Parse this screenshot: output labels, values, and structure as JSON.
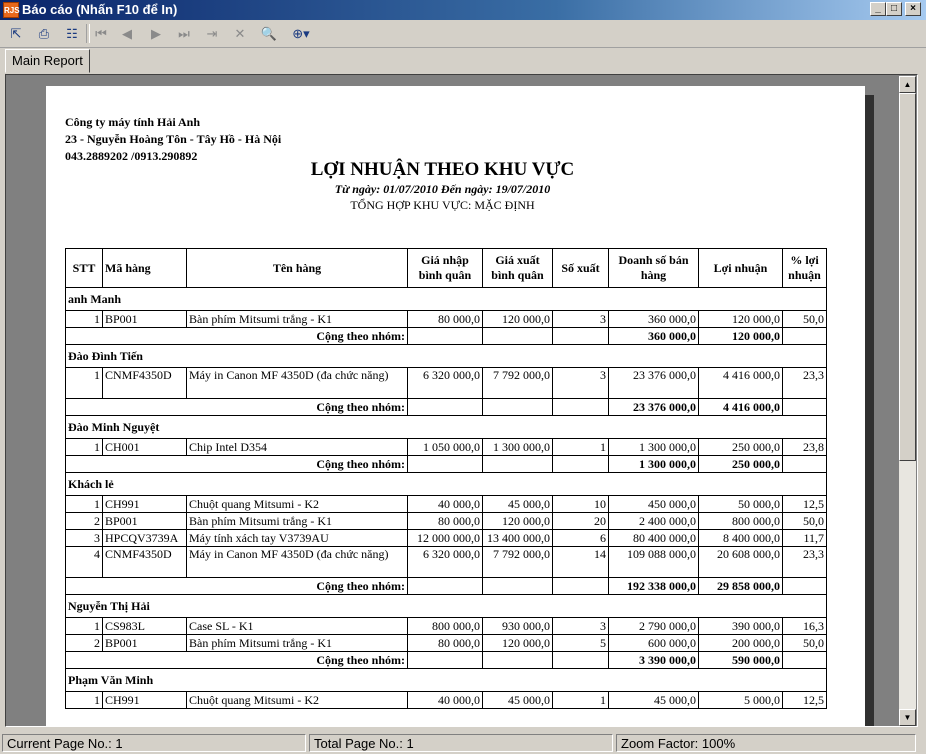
{
  "window": {
    "title": "Báo cáo (Nhấn F10 để In)",
    "icon_text": "RJS"
  },
  "tab": {
    "label": "Main Report"
  },
  "company": {
    "name": "Công ty máy tính Hải Anh",
    "address": "23 - Nguyễn Hoàng Tôn - Tây Hồ - Hà Nội",
    "phone": "043.2889202 /0913.290892"
  },
  "report": {
    "title": "LỢI NHUẬN THEO KHU VỰC",
    "date_range": "Từ ngày: 01/07/2010 Đến ngày: 19/07/2010",
    "summary": "TỔNG HỢP KHU VỰC: MẶC ĐỊNH"
  },
  "columns": [
    "STT",
    "Mã hàng",
    "Tên hàng",
    "Giá nhập bình quân",
    "Giá xuất bình quân",
    "Số xuất",
    "Doanh số bán hàng",
    "Lợi nhuận",
    "% lợi nhuận"
  ],
  "subtotal_label": "Cộng theo nhóm:",
  "groups": [
    {
      "name": "anh Manh",
      "rows": [
        [
          "1",
          "BP001",
          "Bàn phím Mitsumi trắng - K1",
          "80 000,0",
          "120 000,0",
          "3",
          "360 000,0",
          "120 000,0",
          "50,0"
        ]
      ],
      "total_revenue": "360 000,0",
      "total_profit": "120 000,0"
    },
    {
      "name": "Đào Đình Tiến",
      "rows": [
        [
          "1",
          "CNMF4350D",
          "Máy in Canon MF 4350D (đa chức năng)",
          "6 320 000,0",
          "7 792 000,0",
          "3",
          "23 376 000,0",
          "4 416 000,0",
          "23,3"
        ]
      ],
      "total_revenue": "23 376 000,0",
      "total_profit": "4 416 000,0"
    },
    {
      "name": "Đào Minh Nguyệt",
      "rows": [
        [
          "1",
          "CH001",
          "Chip Intel D354",
          "1 050 000,0",
          "1 300 000,0",
          "1",
          "1 300 000,0",
          "250 000,0",
          "23,8"
        ]
      ],
      "total_revenue": "1 300 000,0",
      "total_profit": "250 000,0"
    },
    {
      "name": "Khách lẻ",
      "rows": [
        [
          "1",
          "CH991",
          "Chuột quang Mitsumi - K2",
          "40 000,0",
          "45 000,0",
          "10",
          "450 000,0",
          "50 000,0",
          "12,5"
        ],
        [
          "2",
          "BP001",
          "Bàn phím Mitsumi trắng - K1",
          "80 000,0",
          "120 000,0",
          "20",
          "2 400 000,0",
          "800 000,0",
          "50,0"
        ],
        [
          "3",
          "HPCQV3739A",
          "Máy tính xách tay V3739AU",
          "12 000 000,0",
          "13 400 000,0",
          "6",
          "80 400 000,0",
          "8 400 000,0",
          "11,7"
        ],
        [
          "4",
          "CNMF4350D",
          "Máy in Canon MF 4350D (đa chức năng)",
          "6 320 000,0",
          "7 792 000,0",
          "14",
          "109 088 000,0",
          "20 608 000,0",
          "23,3"
        ]
      ],
      "total_revenue": "192 338 000,0",
      "total_profit": "29 858 000,0"
    },
    {
      "name": "Nguyễn Thị Hải",
      "rows": [
        [
          "1",
          "CS983L",
          "Case SL - K1",
          "800 000,0",
          "930 000,0",
          "3",
          "2 790 000,0",
          "390 000,0",
          "16,3"
        ],
        [
          "2",
          "BP001",
          "Bàn phím Mitsumi trắng - K1",
          "80 000,0",
          "120 000,0",
          "5",
          "600 000,0",
          "200 000,0",
          "50,0"
        ]
      ],
      "total_revenue": "3 390 000,0",
      "total_profit": "590 000,0"
    },
    {
      "name": "Phạm Văn Minh",
      "rows": [
        [
          "1",
          "CH991",
          "Chuột quang Mitsumi - K2",
          "40 000,0",
          "45 000,0",
          "1",
          "45 000,0",
          "5 000,0",
          "12,5"
        ]
      ]
    }
  ],
  "status": {
    "current_page": "Current Page No.: 1",
    "total_page": "Total Page No.: 1",
    "zoom": "Zoom Factor: 100%"
  }
}
